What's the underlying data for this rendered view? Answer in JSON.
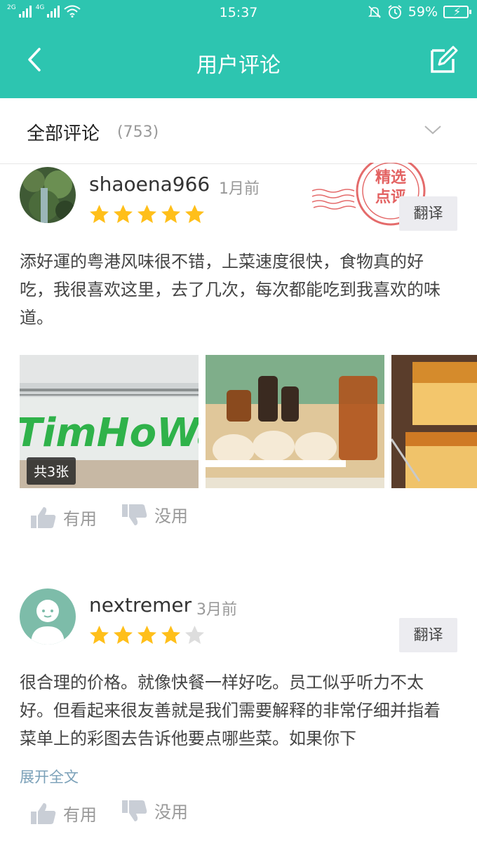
{
  "status_bar": {
    "network_left": "2G",
    "network_right": "4G",
    "time": "15:37",
    "battery": "59%"
  },
  "header": {
    "title": "用户评论"
  },
  "filter": {
    "label": "全部评论",
    "count": "(753)"
  },
  "reviews": [
    {
      "username": "shaoena966",
      "date": "1月前",
      "rating": 5,
      "badge": "精选点评",
      "translate": "翻译",
      "text": "添好運的粤港风味很不错，上菜速度很快，食物真的好吃，我很喜欢这里，去了几次，每次都能吃到我喜欢的味道。",
      "photo_count": "共3张",
      "sign_text": "TimHoWan",
      "useful": "有用",
      "useless": "没用"
    },
    {
      "username": "nextremer",
      "date": "3月前",
      "rating": 4,
      "translate": "翻译",
      "text": "很合理的价格。就像快餐一样好吃。员工似乎听力不太好。但看起来很友善就是我们需要解释的非常仔细并指着菜单上的彩图去告诉他要点哪些菜。如果你下",
      "expand": "展开全文",
      "useful": "有用",
      "useless": "没用"
    }
  ],
  "colors": {
    "accent": "#2dc5b0",
    "star": "#ffbf1a",
    "star_empty": "#dddddd",
    "stamp": "#e05252"
  }
}
